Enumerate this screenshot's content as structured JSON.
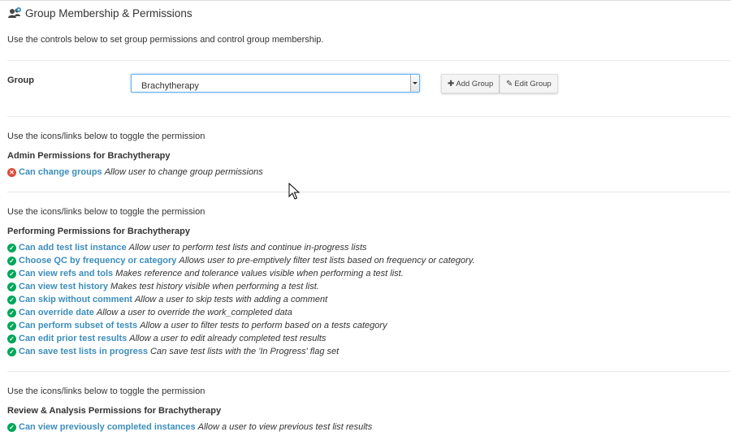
{
  "header": {
    "title": "Group Membership & Permissions",
    "icon": "users-icon"
  },
  "intro": "Use the controls below to set group permissions and control group membership.",
  "group": {
    "label": "Group",
    "selected": "Brachytherapy",
    "add_label": "Add Group",
    "edit_label": "Edit Group"
  },
  "sections": [
    {
      "hint": "Use the icons/links below to toggle the permission",
      "title": "Admin Permissions for Brachytherapy",
      "perms": [
        {
          "name": "Can change groups",
          "desc": "Allow user to change group permissions",
          "granted": false
        }
      ]
    },
    {
      "hint": "Use the icons/links below to toggle the permission",
      "title": "Performing Permissions for Brachytherapy",
      "perms": [
        {
          "name": "Can add test list instance",
          "desc": "Allow user to perform test lists and continue in-progress lists",
          "granted": true
        },
        {
          "name": "Choose QC by frequency or category",
          "desc": "Allows user to pre-emptively filter test lists based on frequency or category.",
          "granted": true
        },
        {
          "name": "Can view refs and tols",
          "desc": "Makes reference and tolerance values visible when performing a test list.",
          "granted": true
        },
        {
          "name": "Can view test history",
          "desc": "Makes test history visible when performing a test list.",
          "granted": true
        },
        {
          "name": "Can skip without comment",
          "desc": "Allow a user to skip tests with adding a comment",
          "granted": true
        },
        {
          "name": "Can override date",
          "desc": "Allow a user to override the work_completed data",
          "granted": true
        },
        {
          "name": "Can perform subset of tests",
          "desc": "Allow a user to filter tests to perform based on a tests category",
          "granted": true
        },
        {
          "name": "Can edit prior test results",
          "desc": "Allow a user to edit already completed test results",
          "granted": true
        },
        {
          "name": "Can save test lists in progress",
          "desc": "Can save test lists with the 'In Progress' flag set",
          "granted": true
        }
      ]
    },
    {
      "hint": "Use the icons/links below to toggle the permission",
      "title": "Review & Analysis Permissions for Brachytherapy",
      "perms": [
        {
          "name": "Can view previously completed instances",
          "desc": "Allow a user to view previous test list results",
          "granted": true
        }
      ]
    }
  ]
}
